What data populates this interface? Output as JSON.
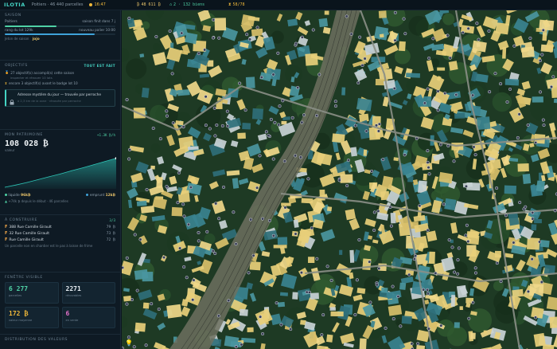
{
  "topbar": {
    "brand": "ILOTIA",
    "subtitle": "Poitiers · 46 440 parcelles",
    "time": "16:47",
    "coins": "48 611 ₿",
    "bien_count": "2 · 132 biens",
    "days": "58/78"
  },
  "saison": {
    "title": "Saison",
    "city": "Poitiers",
    "ends_label": "saison finit dans 7 j",
    "progress_a": 0.47,
    "progress_b": 0.81,
    "rank_label": "rang du lot 129k",
    "rank_right": "nouveau palier 10:00",
    "jeton_label": "Jeton de saison",
    "jeton_value": "jojo"
  },
  "objectifs": {
    "title": "Objectifs",
    "action": "TOUT EST FAIT",
    "line1": "27 objectif(s) accompli(s) cette saison",
    "line1_sub": "inspecter et rénover 10 lots",
    "line2": "encore 3 objectif(s) avant le badge lot 10",
    "mystery_title": "Adresse mystère du jour — trouvée par perroche",
    "mystery_sub": "à 2,3 km de la zone · rénovée par perroche"
  },
  "patrimoine": {
    "title": "Mon patrimoine",
    "rate": "+1.3K ₿/h",
    "value": "108 028 ₿",
    "unit_label": "valeur",
    "liquid_label": "liquide",
    "liquid_value": "96k₿",
    "loan_label": "emprunt",
    "loan_value": "12k₿",
    "growth_note": "+74k ₿ depuis le début · 46 parcelles"
  },
  "chart_data": {
    "type": "area",
    "title": "",
    "x": [
      0,
      1,
      2,
      3,
      4,
      5,
      6,
      7,
      8,
      9,
      10
    ],
    "values": [
      5,
      12,
      20,
      29,
      38,
      47,
      57,
      66,
      76,
      86,
      96
    ],
    "ylim": [
      0,
      110
    ],
    "color": "#2ec4b6"
  },
  "a_construire": {
    "title": "À construire",
    "count": "3/3",
    "items": [
      {
        "label": "388 Rue Camille Girault",
        "cost": "79 ₿"
      },
      {
        "label": "32 Rue Camille Girault",
        "cost": "73 ₿"
      },
      {
        "label": "Rue Camille Girault",
        "cost": "72 ₿"
      }
    ],
    "note": "Un parcelle non en chantier est le pas à laisse de frime"
  },
  "fenetre": {
    "title": "Fenêtre visible",
    "stats": [
      {
        "value": "6 277",
        "label": "parcelles",
        "color": "#4fd1a5"
      },
      {
        "value": "2271",
        "label": "rénovables",
        "color": "#e6edf2"
      },
      {
        "value": "172 ₿",
        "label": "valeur moyenne",
        "color": "#f0b83a"
      },
      {
        "value": "6",
        "label": "en vente",
        "color": "#e070c8"
      }
    ]
  },
  "distribution": {
    "title": "Distribution des valeurs"
  }
}
